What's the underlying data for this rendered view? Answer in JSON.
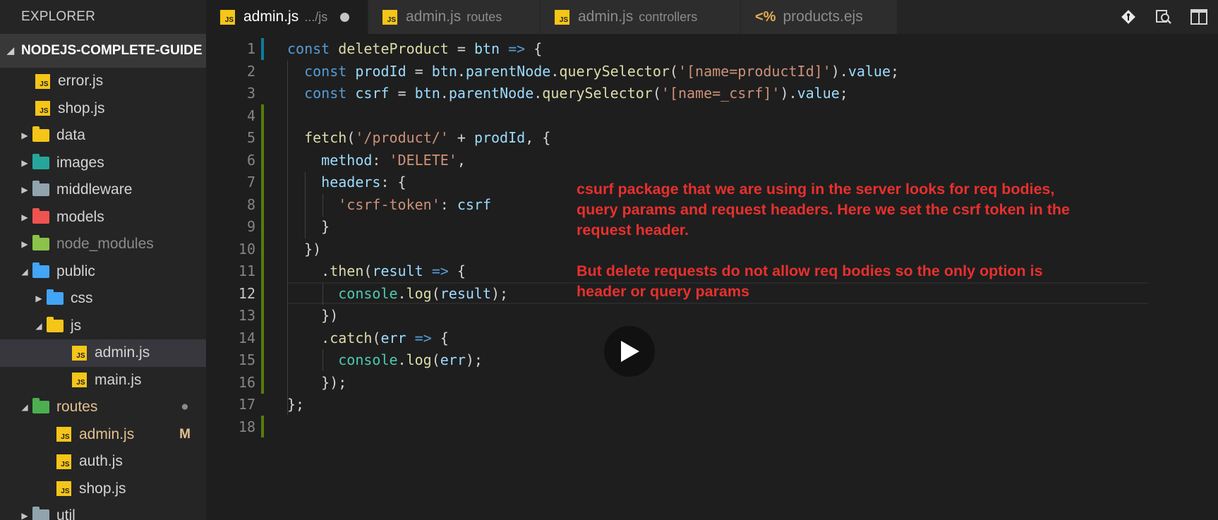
{
  "sidebar": {
    "title": "EXPLORER",
    "section": "NODEJS-COMPLETE-GUIDE",
    "items": [
      {
        "label": "error.js",
        "type": "js"
      },
      {
        "label": "shop.js",
        "type": "js"
      },
      {
        "label": "data",
        "type": "folder"
      },
      {
        "label": "images",
        "type": "folder"
      },
      {
        "label": "middleware",
        "type": "folder"
      },
      {
        "label": "models",
        "type": "folder"
      },
      {
        "label": "node_modules",
        "type": "folder"
      },
      {
        "label": "public",
        "type": "folder"
      },
      {
        "label": "css",
        "type": "folder"
      },
      {
        "label": "js",
        "type": "folder"
      },
      {
        "label": "admin.js",
        "type": "js"
      },
      {
        "label": "main.js",
        "type": "js"
      },
      {
        "label": "routes",
        "type": "folder"
      },
      {
        "label": "admin.js",
        "type": "js",
        "badge": "M"
      },
      {
        "label": "auth.js",
        "type": "js"
      },
      {
        "label": "shop.js",
        "type": "js"
      },
      {
        "label": "util",
        "type": "folder"
      }
    ],
    "routes_badge": "●"
  },
  "tabs": [
    {
      "label": "admin.js",
      "desc": ".../js",
      "active": true,
      "icon": "JS"
    },
    {
      "label": "admin.js",
      "desc": "routes",
      "active": false,
      "icon": "JS"
    },
    {
      "label": "admin.js",
      "desc": "controllers",
      "active": false,
      "icon": "JS"
    },
    {
      "label": "products.ejs",
      "desc": "",
      "active": false,
      "icon": "<%"
    }
  ],
  "editor": {
    "line_numbers": [
      "1",
      "2",
      "3",
      "4",
      "5",
      "6",
      "7",
      "8",
      "9",
      "10",
      "11",
      "12",
      "13",
      "14",
      "15",
      "16",
      "17",
      "18"
    ],
    "current_line": 12
  },
  "annotation": {
    "para1": "csurf package that we are using in the server looks for req bodies, query params and request headers. Here we set the csrf token in the request header.",
    "para2": "But delete requests do not allow req bodies so the only option is header or query params"
  },
  "colors": {
    "git_added": "#587c0c",
    "git_modified": "#0c7d9d",
    "annotation": "#e8302e"
  }
}
